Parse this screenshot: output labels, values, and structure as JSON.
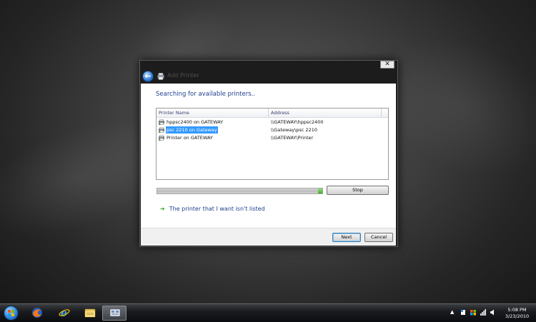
{
  "dialog": {
    "title": "Add Printer",
    "close_label": "✕",
    "heading": "Searching for available printers..",
    "columns": {
      "name": "Printer Name",
      "address": "Address"
    },
    "printers": [
      {
        "name": "hppsc2400 on GATEWAY",
        "address": "\\\\GATEWAY\\hppsc2400",
        "selected": false
      },
      {
        "name": "psc 2210 on Gateway",
        "address": "\\\\Gateway\\psc 2210",
        "selected": true
      },
      {
        "name": "Printer on GATEWAY",
        "address": "\\\\GATEWAY\\Printer",
        "selected": false
      }
    ],
    "progress_fraction": 1.0,
    "stop_label": "Stop",
    "link_label": "The printer that I want isn't listed",
    "next_label": "Next",
    "cancel_label": "Cancel"
  },
  "taskbar": {
    "apps": [
      {
        "icon": "firefox-icon",
        "active": false
      },
      {
        "icon": "internet-explorer-icon",
        "active": false
      },
      {
        "icon": "folder-icon",
        "active": false
      },
      {
        "icon": "devices-printers-icon",
        "active": true
      }
    ],
    "tray_icons": [
      "show-hidden-icons-icon",
      "action-center-icon",
      "network-icon",
      "volume-icon"
    ],
    "time": "5:08 PM",
    "date": "3/23/2010"
  },
  "colors": {
    "heading": "#1e3f8f",
    "selection": "#3399ff",
    "progress_tip": "#3fb024"
  }
}
